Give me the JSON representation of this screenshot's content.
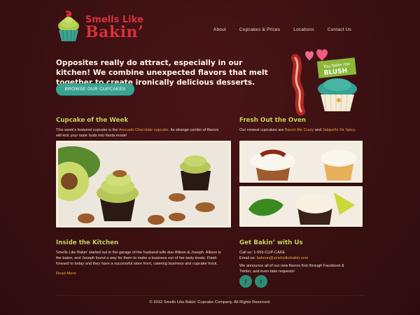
{
  "brand": {
    "line1": "Smells Like",
    "line2": "Bakin’"
  },
  "nav": [
    {
      "label": "About"
    },
    {
      "label": "Cupcakes & Prices"
    },
    {
      "label": "Locations"
    },
    {
      "label": "Contact Us"
    }
  ],
  "hero": {
    "text": "Opposites really do attract, especially in our kitchen! We combine unexpected flavors that melt together to create ironically delicious desserts.",
    "button": "BROWSE OUR CUPCAKES",
    "badge_line1": "You bake me",
    "badge_line2": "BLUSH"
  },
  "week": {
    "title": "Cupcake of the Week",
    "t1": "This week's featured cupcake is the ",
    "link": "Avocado Chocolate cupcake",
    "t2": ". Its strange combo of flavors will kick your taste buds into fiesta mode!"
  },
  "fresh": {
    "title": "Fresh Out the Oven",
    "t1": "Our newest cupcakes are ",
    "link1": "Bacon Me Crazy",
    "t2": " and ",
    "link2": "Jalapeño Sir Spicy",
    "t3": "."
  },
  "kitchen": {
    "title": "Inside the Kitchen",
    "text": "Smells Like Bakin' started out in the garage of the husband wife duo Allison & Joseph. Allison is the baker, and Joseph found a way for them to make a business out of her tasty treats. Flash forward to today and they have a successful store front, catering business and cupcake truck.",
    "read_more": "Read More"
  },
  "contact": {
    "title": "Get Bakin’ with Us",
    "phone": "Call us: 1-555-CUP-CAKE",
    "email_prefix": "Email us: ",
    "email": "bakeon@smellslikebakin.com",
    "announce": "We announce all of our new flavors first through Facebook & Twitter, and even take requests!"
  },
  "social": {
    "facebook": "f",
    "twitter": "t"
  },
  "footer": "© 2012 Smells Like Bakin' Cupcake Company. All Rights Reserved.",
  "colors": {
    "background": "#3a1012",
    "accent_green": "#c2d25a",
    "accent_teal": "#3aa393",
    "link_orange": "#e9a948",
    "brand_red": "#d8313b"
  }
}
